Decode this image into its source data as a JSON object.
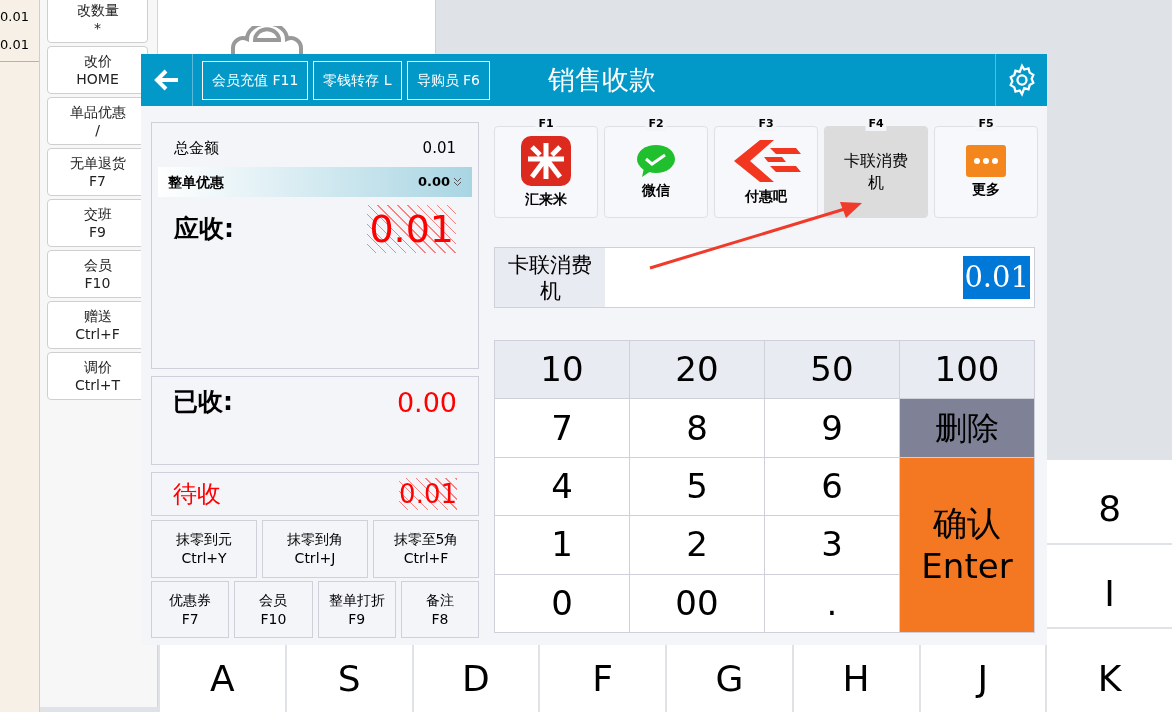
{
  "background": {
    "line_values": [
      "0.01",
      "0.01"
    ],
    "shortcut_buttons": [
      {
        "label": "改数量",
        "key": "*"
      },
      {
        "label": "改价",
        "key": "HOME"
      },
      {
        "label": "单品优惠",
        "key": "/"
      },
      {
        "label": "无单退货",
        "key": "F7"
      },
      {
        "label": "交班",
        "key": "F9"
      },
      {
        "label": "会员",
        "key": "F10"
      },
      {
        "label": "赠送",
        "key": "Ctrl+F"
      },
      {
        "label": "调价",
        "key": "Ctrl+T"
      }
    ],
    "keyboard_keys": [
      "8",
      "I",
      "A",
      "S",
      "D",
      "F",
      "G",
      "H",
      "J",
      "K"
    ]
  },
  "dialog": {
    "title": "销售收款",
    "header_buttons": [
      "会员充值 F11",
      "零钱转存 L",
      "导购员 F6"
    ],
    "summary": {
      "total_label": "总金额",
      "total_value": "0.01",
      "discount_label": "整单优惠",
      "discount_value": "0.00",
      "due_label": "应收:",
      "due_value": "0.01",
      "received_label": "已收:",
      "received_value": "0.00",
      "pending_label": "待收",
      "pending_value": "0.01"
    },
    "rounding_buttons": [
      {
        "label": "抹零到元",
        "key": "Ctrl+Y"
      },
      {
        "label": "抹零到角",
        "key": "Ctrl+J"
      },
      {
        "label": "抹零至5角",
        "key": "Ctrl+F"
      }
    ],
    "action_buttons": [
      {
        "label": "优惠券",
        "key": "F7"
      },
      {
        "label": "会员",
        "key": "F10"
      },
      {
        "label": "整单打折",
        "key": "F9"
      },
      {
        "label": "备注",
        "key": "F8"
      }
    ],
    "payment_methods": [
      {
        "key": "F1",
        "label": "汇来米",
        "kind": "mi",
        "selected": false
      },
      {
        "key": "F2",
        "label": "微信",
        "kind": "wechat",
        "selected": false
      },
      {
        "key": "F3",
        "label": "付惠吧",
        "kind": "chevron",
        "selected": false
      },
      {
        "key": "F4",
        "label": "卡联消费机",
        "kind": "text",
        "selected": true
      },
      {
        "key": "F5",
        "label": "更多",
        "kind": "more",
        "selected": false
      }
    ],
    "payment_entry": {
      "method": "卡联消费机",
      "amount": "0.01"
    },
    "keypad": [
      {
        "label": "10",
        "kind": "quick"
      },
      {
        "label": "20",
        "kind": "quick"
      },
      {
        "label": "50",
        "kind": "quick"
      },
      {
        "label": "100",
        "kind": "quick"
      },
      {
        "label": "7",
        "kind": "digit"
      },
      {
        "label": "8",
        "kind": "digit"
      },
      {
        "label": "9",
        "kind": "digit"
      },
      {
        "label": "删除",
        "kind": "delete"
      },
      {
        "label": "4",
        "kind": "digit"
      },
      {
        "label": "5",
        "kind": "digit"
      },
      {
        "label": "6",
        "kind": "digit"
      },
      {
        "label": "1",
        "kind": "digit"
      },
      {
        "label": "2",
        "kind": "digit"
      },
      {
        "label": "3",
        "kind": "digit"
      },
      {
        "label": "0",
        "kind": "digit"
      },
      {
        "label": "00",
        "kind": "digit"
      },
      {
        "label": ".",
        "kind": "digit"
      },
      {
        "label": "确认",
        "key": "Enter",
        "kind": "confirm"
      }
    ]
  }
}
